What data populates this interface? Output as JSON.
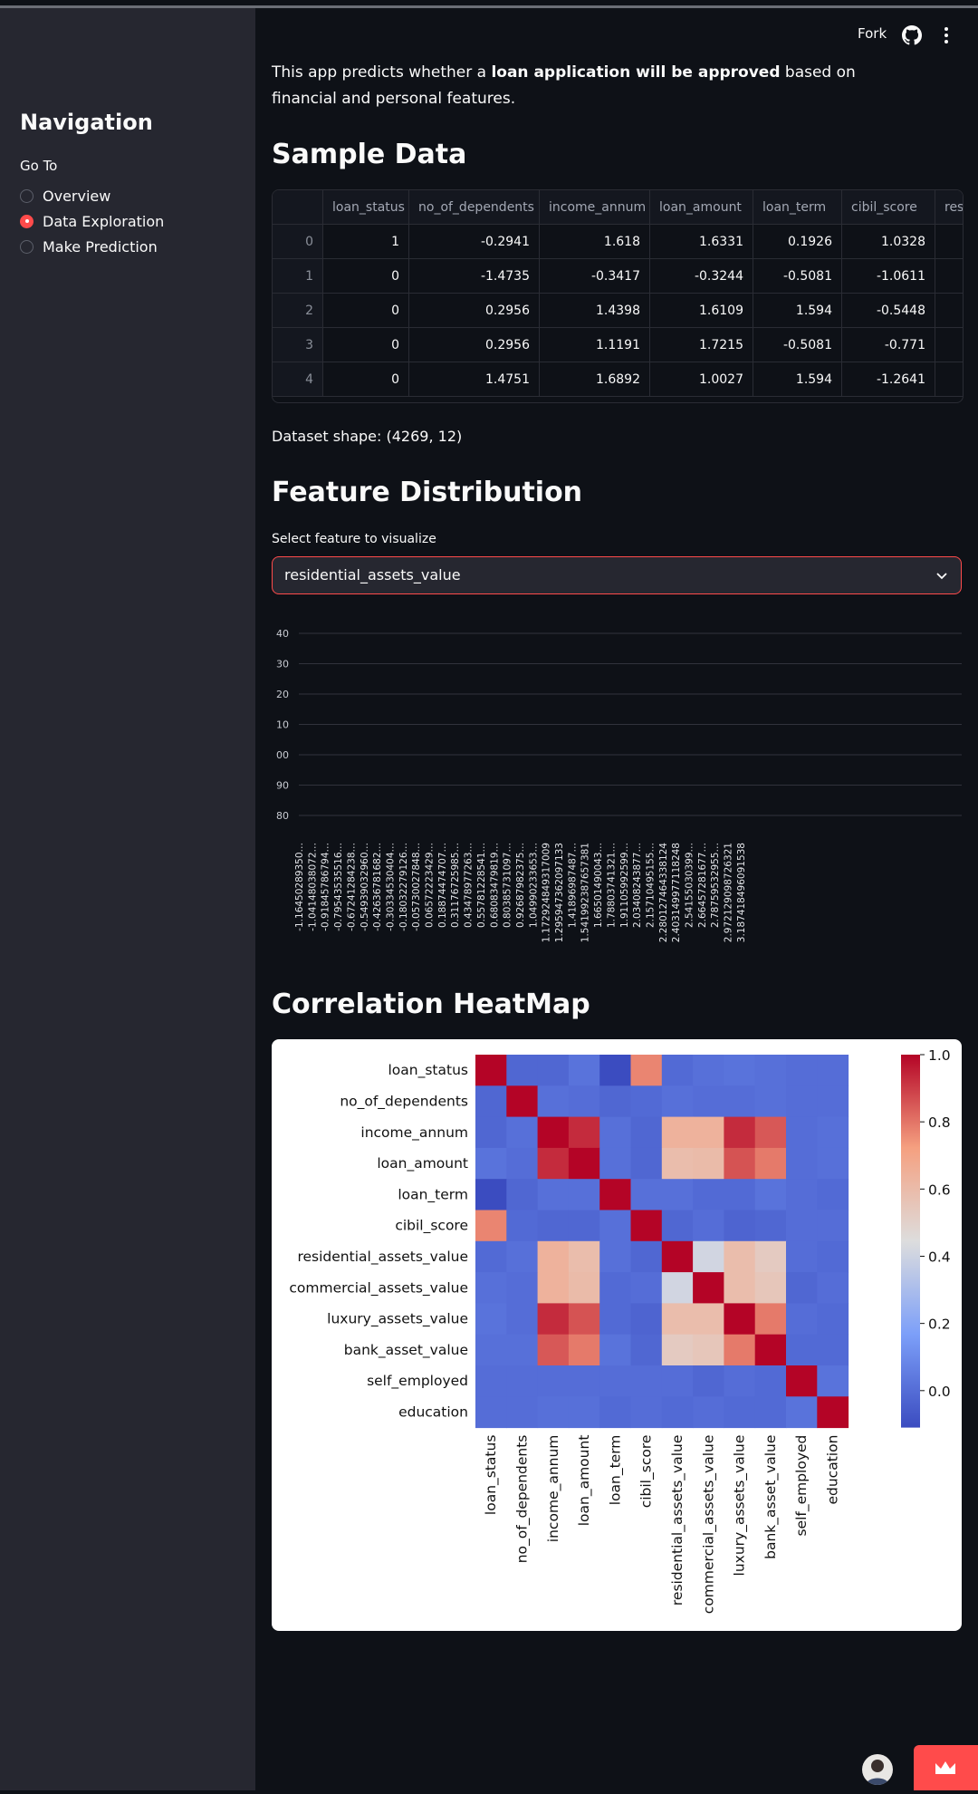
{
  "header": {
    "fork_label": "Fork",
    "github_icon": "github-icon",
    "menu_icon": "kebab-menu-icon"
  },
  "sidebar": {
    "title": "Navigation",
    "radio_label": "Go To",
    "options": [
      {
        "label": "Overview",
        "selected": false
      },
      {
        "label": "Data Exploration",
        "selected": true
      },
      {
        "label": "Make Prediction",
        "selected": false
      }
    ]
  },
  "main": {
    "intro": {
      "before": "This app predicts whether a ",
      "bold": "loan application will be approved",
      "after": " based on financial and personal features."
    },
    "sample_title": "Sample Data",
    "table": {
      "columns": [
        "",
        "loan_status",
        "no_of_dependents",
        "income_annum",
        "loan_amount",
        "loan_term",
        "cibil_score",
        "residen"
      ],
      "rows": [
        [
          "0",
          "1",
          "-0.2941",
          "1.618",
          "1.6331",
          "0.1926",
          "1.0328",
          ""
        ],
        [
          "1",
          "0",
          "-1.4735",
          "-0.3417",
          "-0.3244",
          "-0.5081",
          "-1.0611",
          ""
        ],
        [
          "2",
          "0",
          "0.2956",
          "1.4398",
          "1.6109",
          "1.594",
          "-0.5448",
          ""
        ],
        [
          "3",
          "0",
          "0.2956",
          "1.1191",
          "1.7215",
          "-0.5081",
          "-0.771",
          ""
        ],
        [
          "4",
          "0",
          "1.4751",
          "1.6892",
          "1.0027",
          "1.594",
          "-1.2641",
          ""
        ]
      ]
    },
    "shape_text": "Dataset shape: (4269, 12)",
    "dist_title": "Feature Distribution",
    "select_label": "Select feature to visualize",
    "select_value": "residential_assets_value",
    "heat_title": "Correlation HeatMap"
  },
  "chart_data": [
    {
      "type": "bar",
      "yticks": [
        "40",
        "30",
        "20",
        "10",
        "00",
        "90",
        "80"
      ],
      "categories": [
        "-1.16450289350…",
        "-1.04148038072…",
        "-0.91845786794…",
        "-0.79543535516…",
        "-0.67241284238…",
        "-0.54939032960…",
        "-0.42636781682…",
        "-0.30334530404…",
        "-0.18032279126…",
        "-0.05730027848…",
        "0.06572223429…",
        "0.18874474707…",
        "0.31176725985…",
        "0.43478977263…",
        "0.55781228541…",
        "0.68083479819…",
        "0.80385731097…",
        "0.92687982375…",
        "1.04990233653…",
        "1.1729248493170​09",
        "1.29594736209713​3",
        "1.41896987487…",
        "1.54199238765738​1",
        "1.66501490043…",
        "1.78803741321…",
        "1.91105992599…",
        "2.03408243877…",
        "2.15710495155…",
        "2.280127464338124",
        "2.40314997711824​8",
        "2.54155030399…",
        "2.66457281677…",
        "2.78759532955…",
        "2.97212909872632​1",
        "3.18741849609153​8"
      ],
      "values": []
    },
    {
      "type": "heatmap",
      "labels": [
        "loan_status",
        "no_of_dependents",
        "income_annum",
        "loan_amount",
        "loan_term",
        "cibil_score",
        "residential_assets_value",
        "commercial_assets_value",
        "luxury_assets_value",
        "bank_asset_value",
        "self_employed",
        "education"
      ],
      "matrix": [
        [
          1.0,
          -0.02,
          -0.02,
          0.02,
          -0.11,
          0.77,
          -0.01,
          0.01,
          0.02,
          0.01,
          0.0,
          0.0
        ],
        [
          -0.02,
          1.0,
          0.01,
          -0.0,
          -0.02,
          -0.01,
          0.01,
          -0.0,
          0.0,
          0.01,
          0.0,
          0.0
        ],
        [
          -0.02,
          0.01,
          1.0,
          0.93,
          0.01,
          -0.02,
          0.64,
          0.64,
          0.93,
          0.85,
          0.0,
          0.01
        ],
        [
          0.02,
          -0.0,
          0.93,
          1.0,
          0.01,
          -0.02,
          0.59,
          0.6,
          0.86,
          0.79,
          0.0,
          0.01
        ],
        [
          -0.11,
          -0.02,
          0.01,
          0.01,
          1.0,
          0.01,
          0.01,
          -0.01,
          -0.01,
          0.02,
          0.0,
          -0.01
        ],
        [
          0.77,
          -0.01,
          -0.02,
          -0.02,
          0.01,
          1.0,
          -0.02,
          -0.0,
          -0.03,
          -0.02,
          -0.0,
          0.0
        ],
        [
          -0.01,
          0.01,
          0.64,
          0.59,
          0.01,
          -0.02,
          1.0,
          0.41,
          0.59,
          0.53,
          0.0,
          -0.01
        ],
        [
          0.01,
          -0.0,
          0.64,
          0.6,
          -0.01,
          -0.0,
          0.41,
          1.0,
          0.59,
          0.55,
          -0.02,
          0.0
        ],
        [
          0.02,
          0.0,
          0.93,
          0.86,
          -0.01,
          -0.03,
          0.59,
          0.59,
          1.0,
          0.79,
          0.0,
          -0.01
        ],
        [
          0.01,
          0.01,
          0.85,
          0.79,
          0.02,
          -0.02,
          0.53,
          0.55,
          0.79,
          1.0,
          -0.01,
          -0.01
        ],
        [
          0.0,
          0.0,
          0.0,
          0.0,
          0.0,
          -0.0,
          0.0,
          -0.02,
          0.0,
          -0.01,
          1.0,
          0.02
        ],
        [
          0.0,
          0.0,
          0.01,
          0.01,
          -0.01,
          0.0,
          -0.01,
          0.0,
          -0.01,
          -0.01,
          0.02,
          1.0
        ]
      ],
      "colorbar_ticks": [
        "1.0",
        "0.8",
        "0.6",
        "0.4",
        "0.2",
        "0.0"
      ],
      "vmin": -0.11,
      "vmax": 1.0,
      "colormap": "coolwarm"
    }
  ]
}
